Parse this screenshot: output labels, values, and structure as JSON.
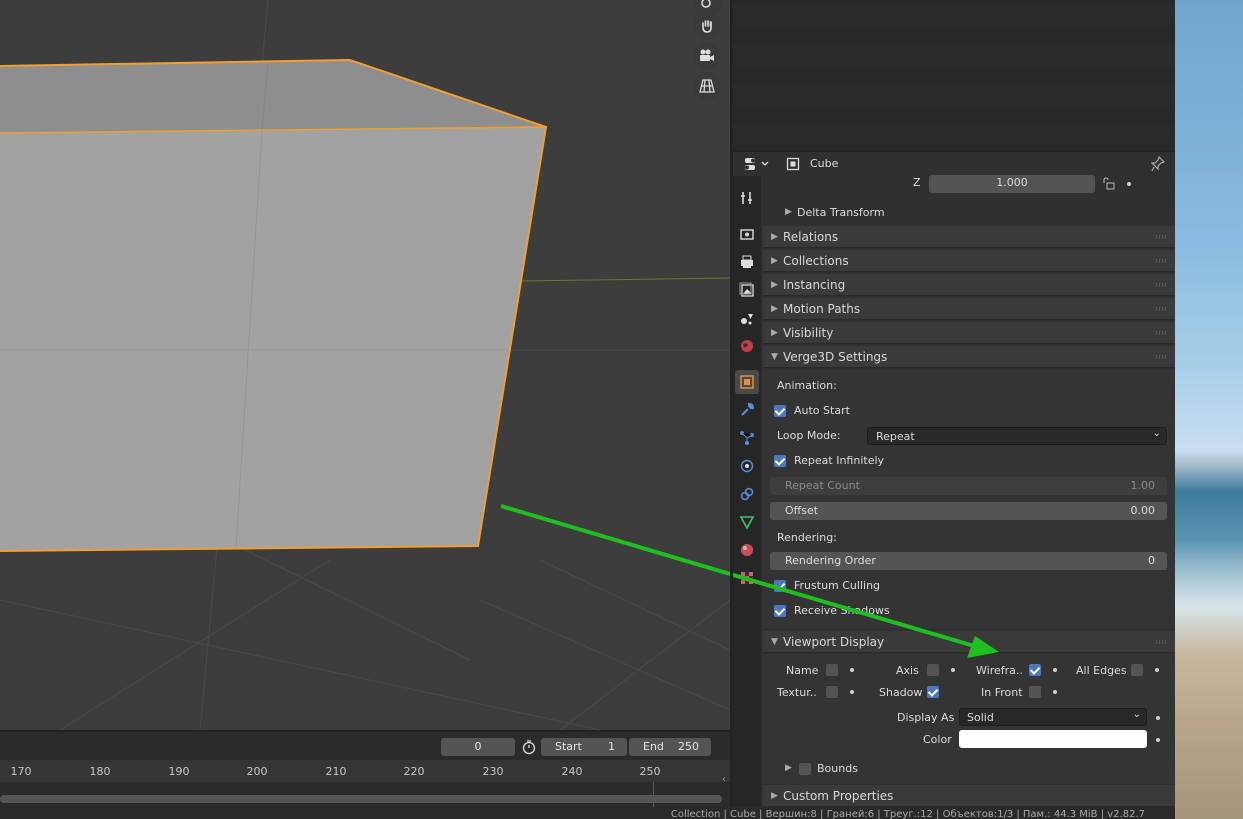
{
  "properties": {
    "object_name": "Cube",
    "z_label": "Z",
    "z_value": "1.000",
    "delta_transform": "Delta Transform",
    "panels": {
      "relations": "Relations",
      "collections": "Collections",
      "instancing": "Instancing",
      "motion_paths": "Motion Paths",
      "visibility": "Visibility",
      "verge3d": "Verge3D Settings",
      "viewport_display": "Viewport Display",
      "custom_properties": "Custom Properties"
    },
    "verge3d": {
      "animation_label": "Animation:",
      "auto_start": "Auto Start",
      "loop_mode_label": "Loop Mode:",
      "loop_mode_value": "Repeat",
      "repeat_infinitely": "Repeat Infinitely",
      "repeat_count_label": "Repeat Count",
      "repeat_count_value": "1.00",
      "offset_label": "Offset",
      "offset_value": "0.00",
      "rendering_label": "Rendering:",
      "rendering_order_label": "Rendering Order",
      "rendering_order_value": "0",
      "frustum_culling": "Frustum Culling",
      "receive_shadows": "Receive Shadows"
    },
    "viewport_display": {
      "name": "Name",
      "axis": "Axis",
      "wireframe": "Wirefra..",
      "all_edges": "All Edges",
      "texture_space": "Textur..",
      "shadow": "Shadow",
      "in_front": "In Front",
      "display_as_label": "Display As",
      "display_as_value": "Solid",
      "color_label": "Color",
      "bounds": "Bounds"
    }
  },
  "timeline": {
    "current_frame": "0",
    "start_label": "Start",
    "start_value": "1",
    "end_label": "End",
    "end_value": "250",
    "ticks": [
      "170",
      "180",
      "190",
      "200",
      "210",
      "220",
      "230",
      "240",
      "250"
    ]
  },
  "status_bar": "Collection | Cube | Вершин:8 | Граней:6 | Треуг.:12 | Объектов:1/3 | Пам.: 44.3 MiB | v2.82.7",
  "colors": {
    "accent": "#4a78c2",
    "selection": "#f0a030",
    "arrow": "#1fbf1f"
  }
}
